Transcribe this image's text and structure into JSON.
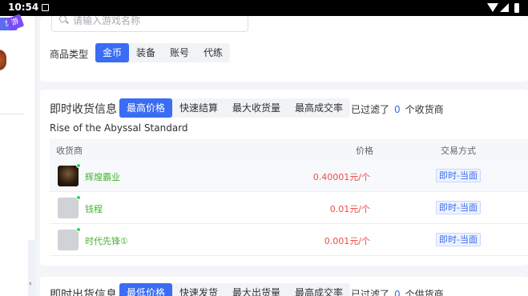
{
  "status_bar": {
    "time": "10:54"
  },
  "sidebar": {
    "badge": "价",
    "badge_tag": "游",
    "collapse_glyph": "‹"
  },
  "search": {
    "placeholder": "请输入游戏名称"
  },
  "goods_type": {
    "label": "商品类型",
    "options": [
      "金币",
      "装备",
      "账号",
      "代练"
    ],
    "selected": "金币"
  },
  "buy_section": {
    "title": "即时收货信息",
    "tabs": [
      "最高价格",
      "快速结算",
      "最大收货量",
      "最高成交率"
    ],
    "selected_tab": "最高价格",
    "filtered_prefix": "已过滤了",
    "filtered_count": "0",
    "filtered_suffix": "个收货商",
    "game_name": "Rise of the Abyssal Standard",
    "columns": {
      "merchant": "收货商",
      "price": "价格",
      "method": "交易方式"
    },
    "rows": [
      {
        "name": "辉煌霸业",
        "price": "0.40001元/个",
        "method": "即时-当面",
        "online": true
      },
      {
        "name": "钱程",
        "price": "0.01元/个",
        "method": "即时-当面",
        "online": true
      },
      {
        "name": "时代先锋①",
        "price": "0.001元/个",
        "method": "即时-当面",
        "online": true
      }
    ]
  },
  "sell_section": {
    "title": "即时出货信息",
    "tabs": [
      "最低价格",
      "快速发货",
      "最大出货量",
      "最高成交率"
    ],
    "selected_tab": "最低价格",
    "filtered_prefix": "已过滤了",
    "filtered_count": "0",
    "filtered_suffix": "个供货商"
  },
  "colors": {
    "accent": "#3a6cf4",
    "price": "#f04a48",
    "merchant": "#46b32e",
    "online": "#3ecf5a"
  }
}
